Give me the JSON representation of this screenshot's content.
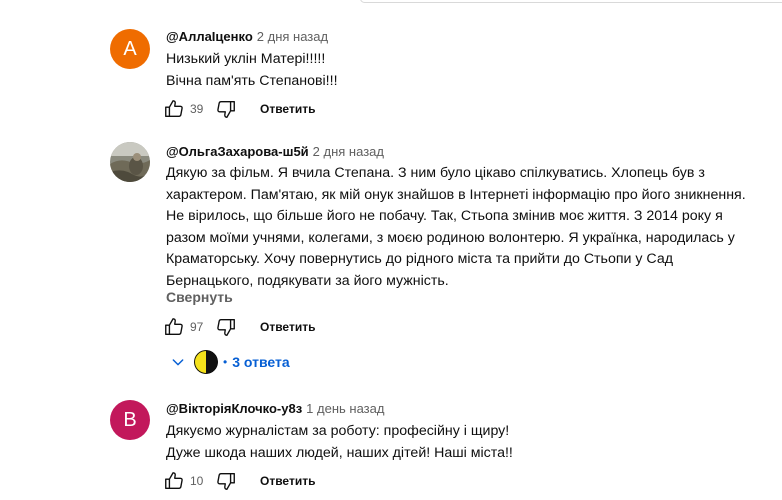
{
  "comments": [
    {
      "author": "@АллаІценко",
      "time": "2 дня назад",
      "avatar_letter": "A",
      "avatar_color": "#ef6c00",
      "lines": [
        "Низький уклін Матері!!!!!",
        "Вічна пам'ять Степанові!!!"
      ],
      "likes": "39",
      "reply_label": "Ответить"
    },
    {
      "author": "@ОльгаЗахарова-ш5й",
      "time": "2 дня назад",
      "lines": [
        "Дякую за фільм. Я вчила Степана. З ним було цікаво спілкуватись. Хлопець був з",
        "характером. Пам'ятаю, як мій онук знайшов в Інтернеті інформацію про його зникнення.",
        "Не вірилось, що більше його не побачу. Так, Стьопа змінив моє життя. З 2014 року я",
        "разом моїми учнями, колегами, з моєю родиною волонтерю. Я українка, народилась у",
        "Краматорську. Хочу повернутись до рідного міста та прийти до Стьопи у Сад",
        "Бернацького, подякувати за його мужність."
      ],
      "collapse_label": "Свернуть",
      "likes": "97",
      "reply_label": "Ответить",
      "replies_label": "3 ответа"
    },
    {
      "author": "@ВікторіяКлочко-у8з",
      "time": "1 день назад",
      "avatar_letter": "B",
      "avatar_color": "#c2185b",
      "lines": [
        "Дякуємо журналістам за роботу: професійну і щиру!",
        "Дуже шкода наших людей, наших дітей! Наші міста!!"
      ],
      "likes": "10",
      "reply_label": "Ответить"
    }
  ]
}
